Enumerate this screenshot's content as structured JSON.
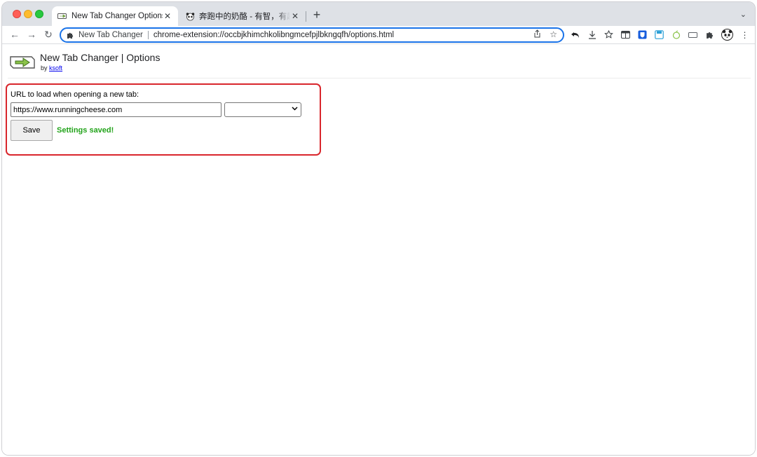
{
  "browser": {
    "tabs": [
      {
        "title": "New Tab Changer Options",
        "active": true,
        "favicon": "arrow-icon"
      },
      {
        "title": "奔跑中的奶酪 - 有智，有趣，",
        "active": false,
        "favicon": "panda-icon"
      }
    ],
    "new_tab_symbol": "+",
    "omnibox": {
      "site_chip": "New Tab Changer",
      "url": "chrome-extension://occbjkhimchkolibngmcefpjlbkngqfh/options.html"
    }
  },
  "page": {
    "title": "New Tab Changer | Options",
    "by_prefix": "by",
    "author_link": "ksoft",
    "url_label": "URL to load when opening a new tab:",
    "url_value": "https://www.runningcheese.com",
    "preset_selected": "",
    "save_label": "Save",
    "status_text": "Settings saved!"
  },
  "colors": {
    "accent": "#1a73e8",
    "highlight_border": "#d9262c",
    "status_green": "#22a31a"
  }
}
